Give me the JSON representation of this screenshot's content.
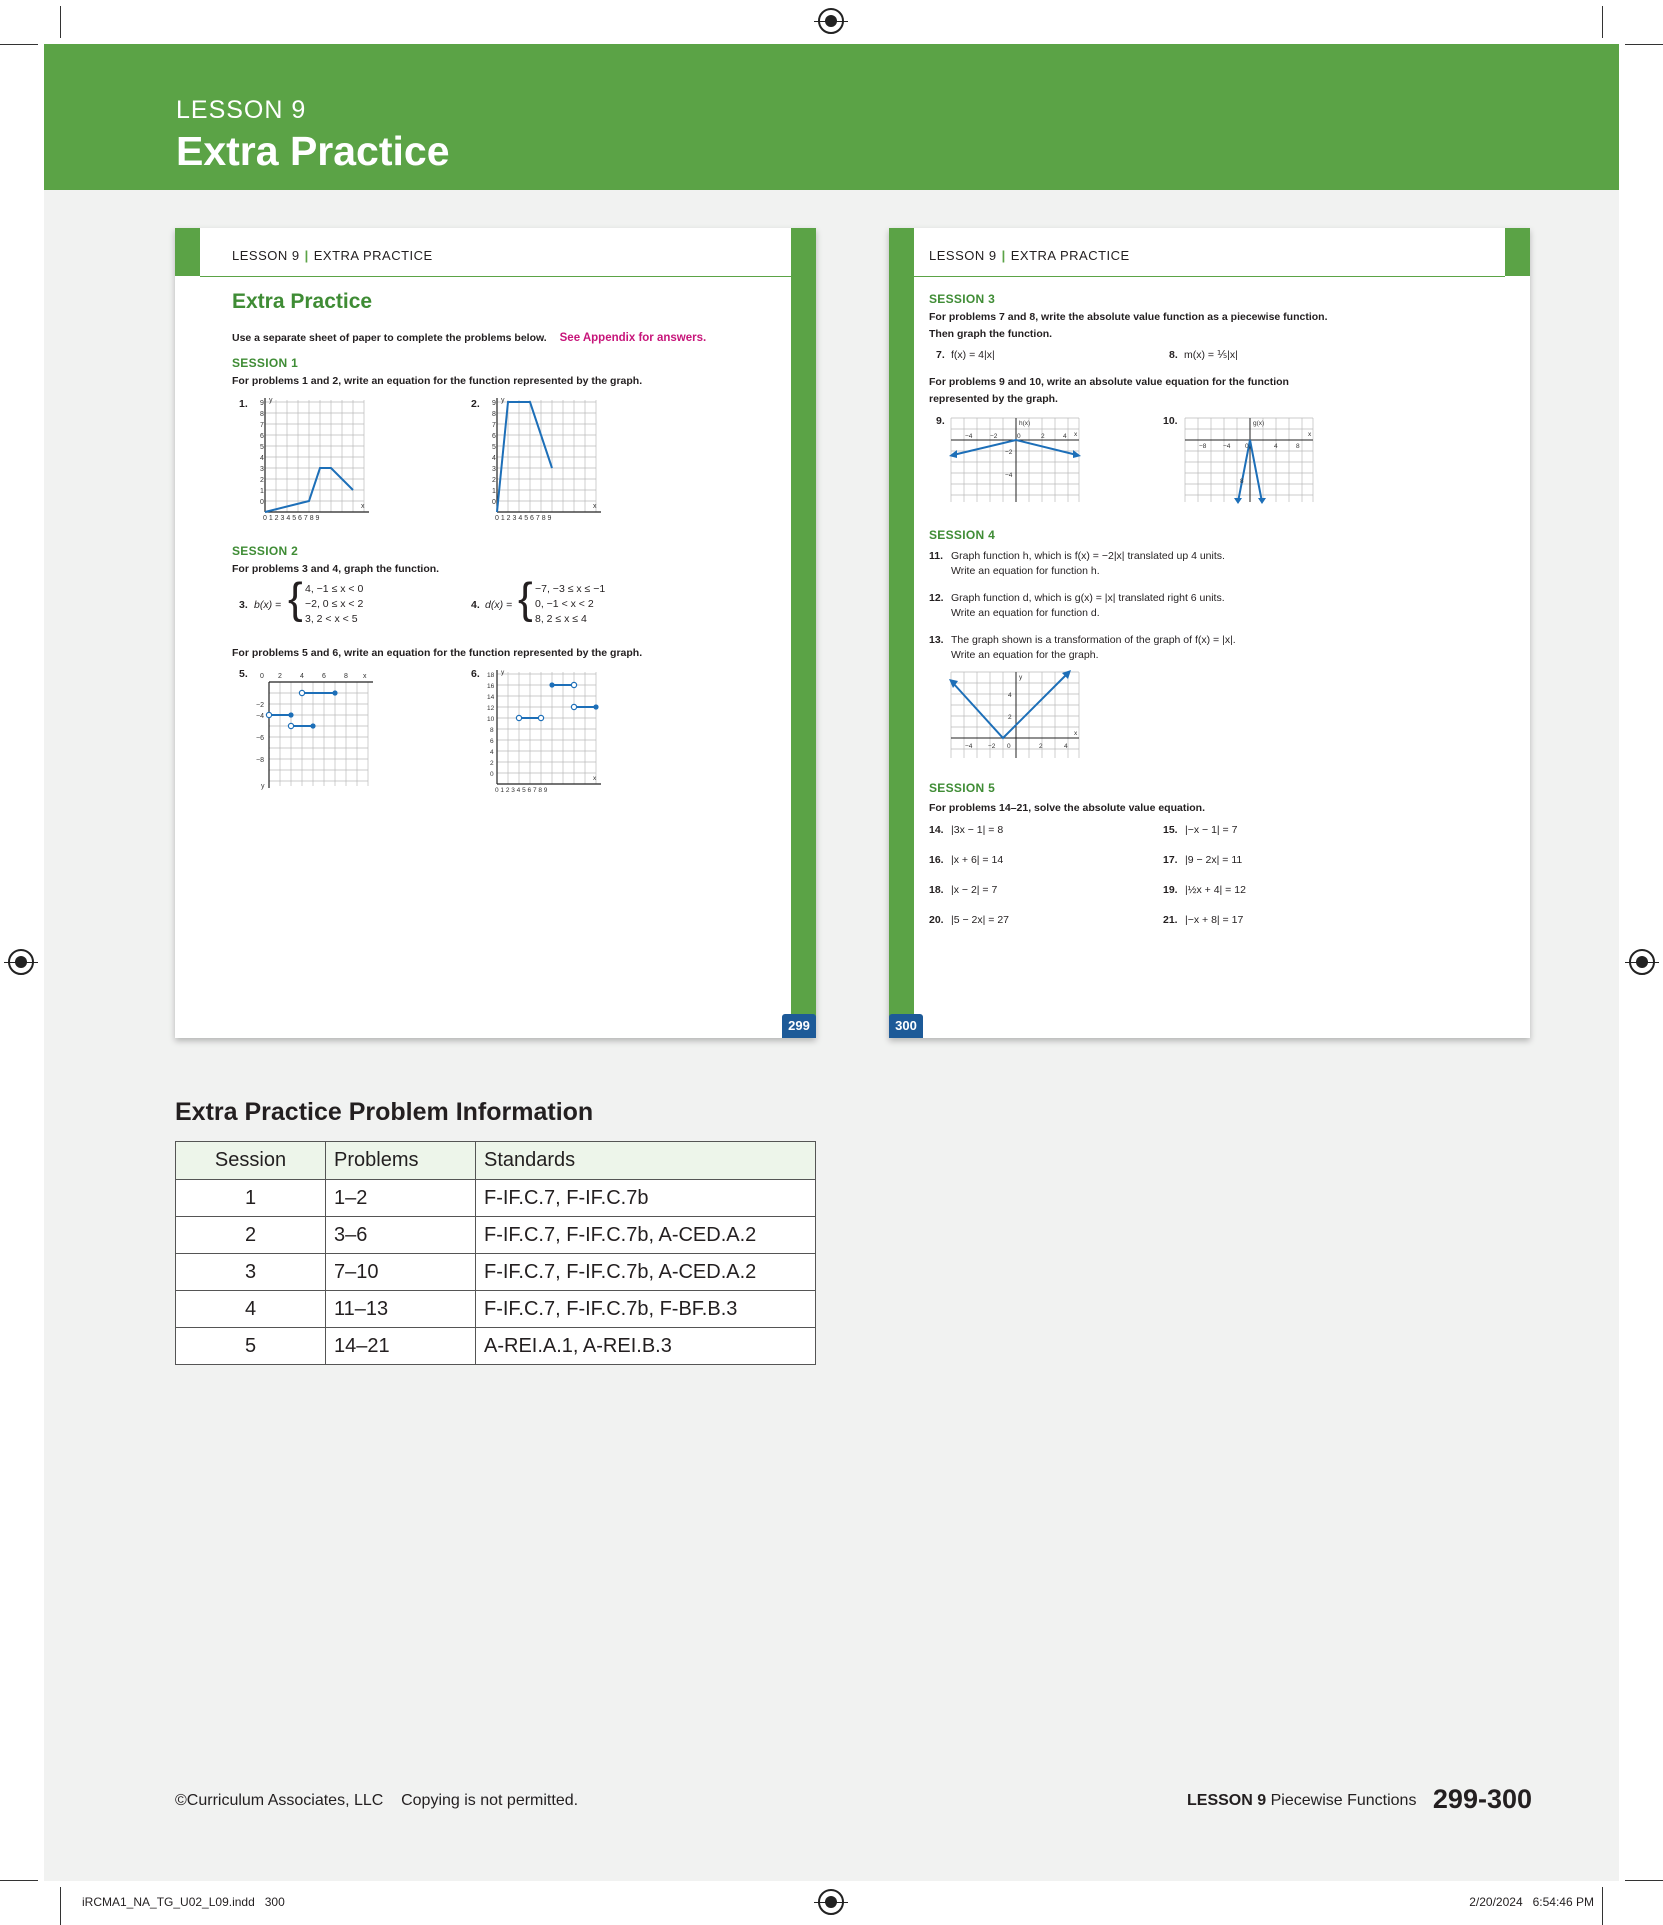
{
  "banner": {
    "kicker": "LESSON 9",
    "title": "Extra Practice"
  },
  "page_left": {
    "header_a": "LESSON 9",
    "header_sep": "|",
    "header_b": "EXTRA PRACTICE",
    "title": "Extra Practice",
    "intro": "Use a separate sheet of paper to complete the problems below.",
    "intro_link": "See Appendix for answers.",
    "s1": "SESSION 1",
    "s1_dir": "For problems 1 and 2, write an equation for the function represented by the graph.",
    "p1": "1.",
    "p2": "2.",
    "s2": "SESSION 2",
    "s2_dir": "For problems 3 and 4, graph the function.",
    "p3": "3.",
    "p3_fn": "b(x) =",
    "p3_cases": [
      "4,  −1 ≤ x <  0",
      "−2,   0 ≤ x < 2",
      "3,    2 < x < 5"
    ],
    "p4": "4.",
    "p4_fn": "d(x) =",
    "p4_cases": [
      "−7, −3 ≤ x ≤ −1",
      "0, −1 < x < 2",
      "8,    2 ≤ x ≤ 4"
    ],
    "s2_dir2": "For problems 5 and 6, write an equation for the function represented by the graph.",
    "p5": "5.",
    "p6": "6.",
    "page_number": "299"
  },
  "page_right": {
    "header_a": "LESSON 9",
    "header_sep": "|",
    "header_b": "EXTRA PRACTICE",
    "s3": "SESSION 3",
    "s3_dir_1": "For problems 7 and 8, write the absolute value function as a piecewise function.",
    "s3_dir_2": "Then graph the function.",
    "p7": "7.",
    "p7_eq": "f(x) = 4|x|",
    "p8": "8.",
    "p8_eq": "m(x) = ⅕|x|",
    "s3_dir2_1": "For problems 9 and 10, write an absolute value equation for the function",
    "s3_dir2_2": "represented by the graph.",
    "p9": "9.",
    "p10": "10.",
    "s4": "SESSION 4",
    "p11": "11.",
    "p11_a": "Graph function h, which is f(x) = −2|x| translated up 4 units.",
    "p11_b": "Write an equation for function h.",
    "p12": "12.",
    "p12_a": "Graph function d, which is g(x) = |x| translated right 6 units.",
    "p12_b": "Write an equation for function d.",
    "p13": "13.",
    "p13_a": "The graph shown is a transformation of the graph of f(x) = |x|.",
    "p13_b": "Write an equation for the graph.",
    "s5": "SESSION 5",
    "s5_dir": "For problems 14–21, solve the absolute value equation.",
    "equations": [
      {
        "n": "14.",
        "eq": "|3x − 1| = 8"
      },
      {
        "n": "15.",
        "eq": "|−x − 1| = 7"
      },
      {
        "n": "16.",
        "eq": "|x + 6| = 14"
      },
      {
        "n": "17.",
        "eq": "|9 − 2x| = 11"
      },
      {
        "n": "18.",
        "eq": "|x − 2| = 7"
      },
      {
        "n": "19.",
        "eq": "|½x + 4| = 12"
      },
      {
        "n": "20.",
        "eq": "|5 − 2x| = 27"
      },
      {
        "n": "21.",
        "eq": "|−x + 8| = 17"
      }
    ],
    "page_number": "300"
  },
  "info": {
    "title": "Extra Practice Problem Information",
    "headers": [
      "Session",
      "Problems",
      "Standards"
    ],
    "rows": [
      [
        "1",
        "1–2",
        "F-IF.C.7, F-IF.C.7b"
      ],
      [
        "2",
        "3–6",
        "F-IF.C.7, F-IF.C.7b, A-CED.A.2"
      ],
      [
        "3",
        "7–10",
        "F-IF.C.7, F-IF.C.7b, A-CED.A.2"
      ],
      [
        "4",
        "11–13",
        "F-IF.C.7, F-IF.C.7b, F-BF.B.3"
      ],
      [
        "5",
        "14–21",
        "A-REI.A.1, A-REI.B.3"
      ]
    ]
  },
  "footer": {
    "copyright": "©Curriculum Associates, LLC    Copying is not permitted.",
    "lesson": "LESSON 9",
    "topic": "Piecewise Functions",
    "pages": "299-300"
  },
  "slug": {
    "file": "iRCMA1_NA_TG_U02_L09.indd   300",
    "stamp": "2/20/2024   6:54:46 PM"
  },
  "colors": {
    "green": "#5ba346",
    "blue": "#1d6fb8",
    "page_number_bg": "#1d5a98",
    "link_pink": "#c7157a"
  }
}
